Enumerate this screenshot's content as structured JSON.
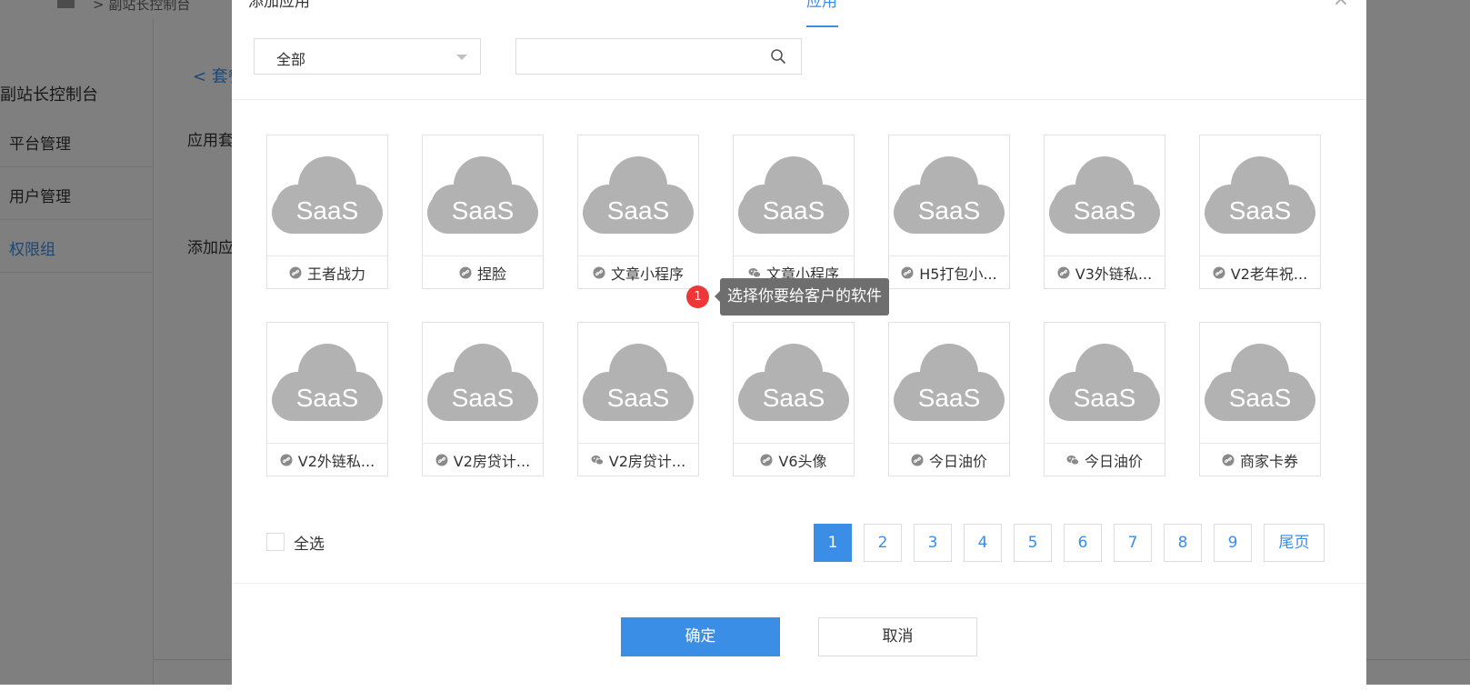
{
  "background": {
    "topbar_text": "> 副站长控制台",
    "sidebar_title": "副站长控制台",
    "sidebar_items": [
      {
        "label": "平台管理",
        "active": false
      },
      {
        "label": "用户管理",
        "active": false
      },
      {
        "label": "权限组",
        "active": true
      }
    ],
    "back_link": "< 套餐",
    "field_label_1": "应用套",
    "field_label_2": "添加应"
  },
  "modal": {
    "title": "添加应用",
    "tab": "应用",
    "close": "×",
    "filter": {
      "selected": "全部"
    },
    "search": {
      "value": "",
      "placeholder": ""
    },
    "card_thumb_text": "SaaS",
    "apps": [
      {
        "label": "王者战力",
        "icon": "link-icon"
      },
      {
        "label": "捏脸",
        "icon": "link-icon"
      },
      {
        "label": "文章小程序",
        "icon": "link-icon"
      },
      {
        "label": "文章小程序",
        "icon": "wechat-icon"
      },
      {
        "label": "H5打包小...",
        "icon": "link-icon"
      },
      {
        "label": "V3外链私...",
        "icon": "link-icon"
      },
      {
        "label": "V2老年祝...",
        "icon": "link-icon"
      },
      {
        "label": "V2外链私...",
        "icon": "link-icon"
      },
      {
        "label": "V2房贷计...",
        "icon": "link-icon"
      },
      {
        "label": "V2房贷计...",
        "icon": "wechat-icon"
      },
      {
        "label": "V6头像",
        "icon": "link-icon"
      },
      {
        "label": "今日油价",
        "icon": "link-icon"
      },
      {
        "label": "今日油价",
        "icon": "wechat-icon"
      },
      {
        "label": "商家卡券",
        "icon": "link-icon"
      }
    ],
    "tooltip": {
      "badge": "1",
      "text": "选择你要给客户的软件"
    },
    "select_all_label": "全选",
    "pagination": {
      "pages": [
        "1",
        "2",
        "3",
        "4",
        "5",
        "6",
        "7",
        "8",
        "9"
      ],
      "current": "1",
      "last_label": "尾页"
    },
    "confirm_label": "确定",
    "cancel_label": "取消"
  },
  "colors": {
    "accent": "#3a8ee6",
    "badge": "#ee3838",
    "cloud": "#b2b2b2"
  }
}
